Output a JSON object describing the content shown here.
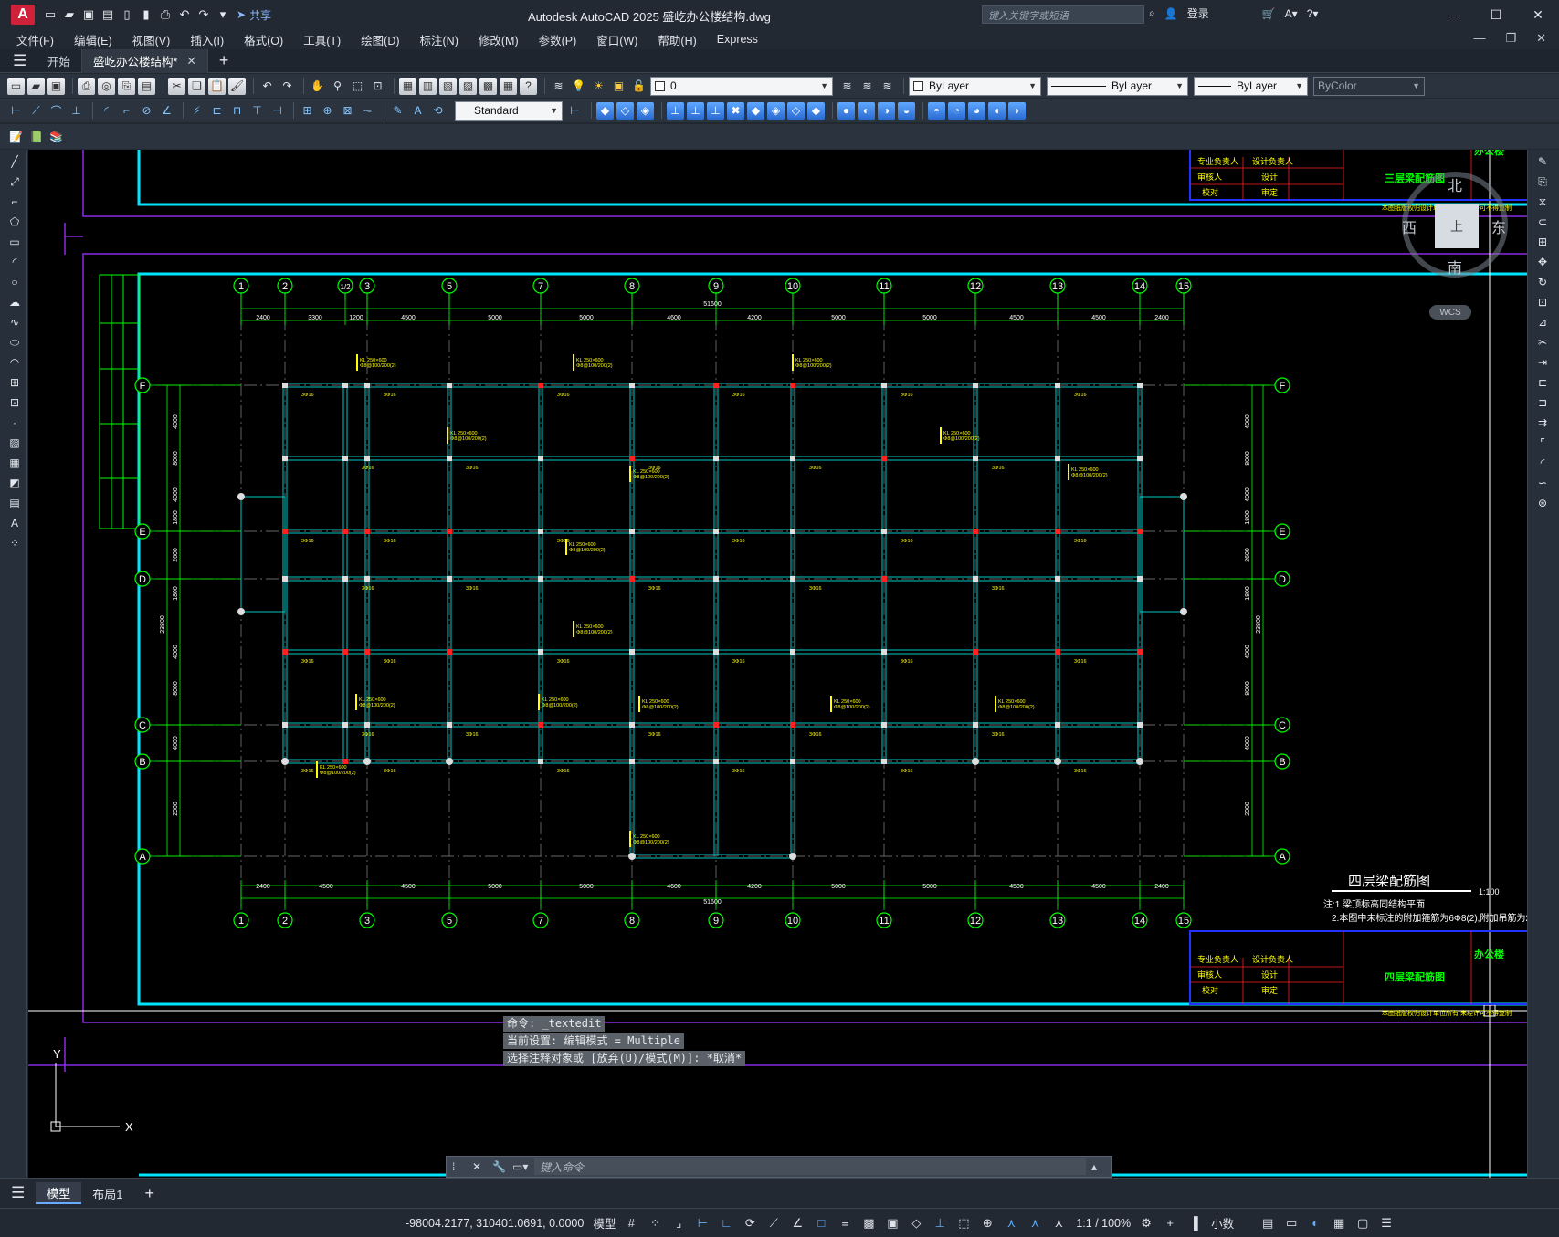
{
  "window": {
    "title": "Autodesk AutoCAD 2025    盛屹办公楼结构.dwg",
    "share_label": "共享",
    "search_placeholder": "键入关键字或短语",
    "login_label": "登录",
    "logo_letter": "A"
  },
  "menu": [
    "文件(F)",
    "编辑(E)",
    "视图(V)",
    "插入(I)",
    "格式(O)",
    "工具(T)",
    "绘图(D)",
    "标注(N)",
    "修改(M)",
    "参数(P)",
    "窗口(W)",
    "帮助(H)",
    "Express"
  ],
  "tabs": {
    "start": "开始",
    "active_doc": "盛屹办公楼结构*"
  },
  "toolbar": {
    "layer_value": "0",
    "color_value": "ByLayer",
    "linetype_value": "ByLayer",
    "lineweight_value": "ByLayer",
    "plotstyle_value": "ByColor",
    "dimstyle_value": "Standard"
  },
  "drawing": {
    "axis_top": [
      "1",
      "2",
      "1/2",
      "3",
      "5",
      "7",
      "8",
      "9",
      "10",
      "11",
      "12",
      "13",
      "14",
      "15"
    ],
    "axis_bottom": [
      "1",
      "2",
      "3",
      "5",
      "7",
      "8",
      "9",
      "10",
      "11",
      "12",
      "13",
      "14",
      "15"
    ],
    "axis_rows": [
      "F",
      "E",
      "D",
      "C",
      "B",
      "A"
    ],
    "top_dims": [
      "2400",
      "3300",
      "1200",
      "4500",
      "5000",
      "5000",
      "4600",
      "4200",
      "5000",
      "5000",
      "4500",
      "4500",
      "2400"
    ],
    "bottom_dims": [
      "2400",
      "4500",
      "4500",
      "5000",
      "5000",
      "4600",
      "4200",
      "5000",
      "5000",
      "4500",
      "4500",
      "2400"
    ],
    "total_dim": "51600",
    "left_dims": [
      "4000",
      "8000",
      "4000",
      "1800",
      "2600",
      "1800",
      "23800",
      "4000",
      "8000",
      "4000",
      "2000",
      "5200"
    ],
    "right_dims": [
      "4000",
      "8000",
      "4000",
      "1800",
      "2600",
      "1800",
      "23800",
      "4000",
      "8000",
      "4000",
      "2000",
      "5200"
    ],
    "plan_title": "四层梁配筋图",
    "plan_scale": "1:100",
    "note_1": "注:1.梁顶标高同结构平面",
    "note_2": "2.本图中未标注的附加箍筋为6Φ8(2),附加吊筋为2Φ1",
    "titleblock_top": {
      "name": "三层梁配筋图",
      "project": "办公楼",
      "row1a": "专业负责人",
      "row1b": "设计负责人",
      "row2a": "审核人",
      "row2b": "设计",
      "row3a": "校对",
      "row3b": "审定",
      "footer": "本图纸版权归设计单位所有 未经许可不得复制"
    },
    "titleblock_bottom": {
      "name": "四层梁配筋图",
      "project": "办公楼",
      "row1a": "专业负责人",
      "row1b": "设计负责人",
      "row2a": "审核人",
      "row2b": "设计",
      "row3a": "校对",
      "row3b": "审定",
      "footer": "本图纸版权归设计单位所有 未经许可不得复制"
    }
  },
  "viewcube": {
    "north": "北",
    "south": "南",
    "east": "东",
    "west": "西",
    "face": "上",
    "wcs": "WCS"
  },
  "command": {
    "history": [
      "命令:  _textedit",
      "当前设置: 编辑模式 = Multiple",
      "选择注释对象或 [放弃(U)/模式(M)]: *取消*"
    ],
    "placeholder": "键入命令"
  },
  "layout_tabs": {
    "model": "模型",
    "layout1": "布局1"
  },
  "status": {
    "coords": "-98004.2177, 310401.0691, 0.0000",
    "space": "模型",
    "scale": "1:1 / 100%",
    "units": "小数"
  },
  "colors": {
    "accent": "#5fb0ff",
    "frame": "#00e5ff",
    "grid": "#00ff00",
    "beam": "#00c8c8",
    "label": "#ffff00",
    "column": "#ff2020"
  }
}
